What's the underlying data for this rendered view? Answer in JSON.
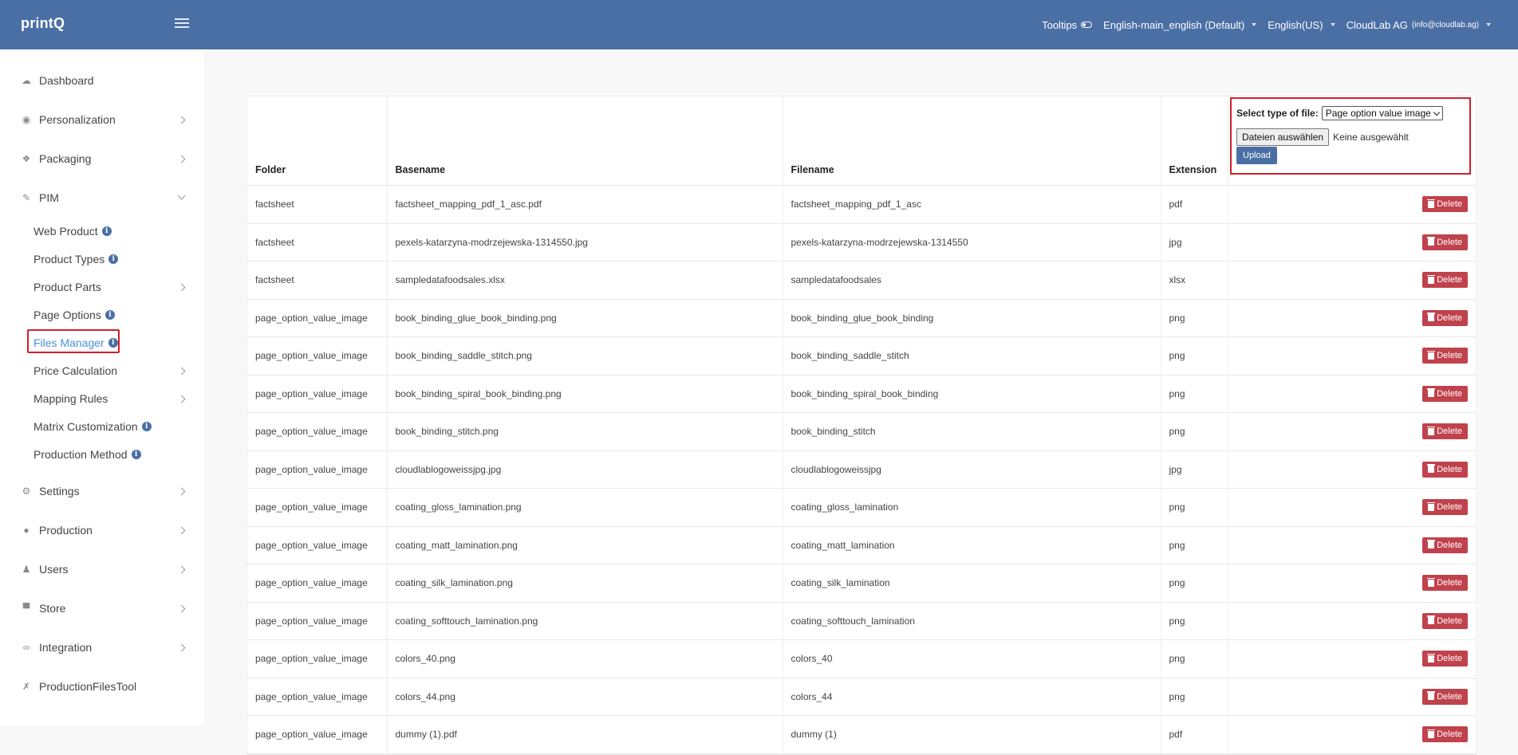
{
  "app": {
    "logo": "printQ"
  },
  "topnav": {
    "tooltips": "Tooltips",
    "language_store": "English-main_english (Default)",
    "locale": "English(US)",
    "account": "CloudLab AG",
    "account_email": "(info@cloudlab.ag)"
  },
  "sidebar": {
    "items": [
      {
        "label": "Dashboard"
      },
      {
        "label": "Personalization"
      },
      {
        "label": "Packaging"
      },
      {
        "label": "PIM"
      },
      {
        "label": "Settings"
      },
      {
        "label": "Production"
      },
      {
        "label": "Users"
      },
      {
        "label": "Store"
      },
      {
        "label": "Integration"
      },
      {
        "label": "ProductionFilesTool"
      }
    ],
    "pim_sub": [
      {
        "label": "Web Product"
      },
      {
        "label": "Product Types"
      },
      {
        "label": "Product Parts"
      },
      {
        "label": "Page Options"
      },
      {
        "label": "Files Manager"
      },
      {
        "label": "Price Calculation"
      },
      {
        "label": "Mapping Rules"
      },
      {
        "label": "Matrix Customization"
      },
      {
        "label": "Production Method"
      }
    ]
  },
  "upload": {
    "select_label": "Select type of file:",
    "selected_type": "Page option value image",
    "choose_files": "Dateien auswählen",
    "no_file": "Keine ausgewählt",
    "upload_button": "Upload"
  },
  "table": {
    "headers": [
      "Folder",
      "Basename",
      "Filename",
      "Extension",
      ""
    ],
    "delete_label": "Delete",
    "rows": [
      [
        "factsheet",
        "factsheet_mapping_pdf_1_asc.pdf",
        "factsheet_mapping_pdf_1_asc",
        "pdf"
      ],
      [
        "factsheet",
        "pexels-katarzyna-modrzejewska-1314550.jpg",
        "pexels-katarzyna-modrzejewska-1314550",
        "jpg"
      ],
      [
        "factsheet",
        "sampledatafoodsales.xlsx",
        "sampledatafoodsales",
        "xlsx"
      ],
      [
        "page_option_value_image",
        "book_binding_glue_book_binding.png",
        "book_binding_glue_book_binding",
        "png"
      ],
      [
        "page_option_value_image",
        "book_binding_saddle_stitch.png",
        "book_binding_saddle_stitch",
        "png"
      ],
      [
        "page_option_value_image",
        "book_binding_spiral_book_binding.png",
        "book_binding_spiral_book_binding",
        "png"
      ],
      [
        "page_option_value_image",
        "book_binding_stitch.png",
        "book_binding_stitch",
        "png"
      ],
      [
        "page_option_value_image",
        "cloudlablogoweissjpg.jpg",
        "cloudlablogoweissjpg",
        "jpg"
      ],
      [
        "page_option_value_image",
        "coating_gloss_lamination.png",
        "coating_gloss_lamination",
        "png"
      ],
      [
        "page_option_value_image",
        "coating_matt_lamination.png",
        "coating_matt_lamination",
        "png"
      ],
      [
        "page_option_value_image",
        "coating_silk_lamination.png",
        "coating_silk_lamination",
        "png"
      ],
      [
        "page_option_value_image",
        "coating_softtouch_lamination.png",
        "coating_softtouch_lamination",
        "png"
      ],
      [
        "page_option_value_image",
        "colors_40.png",
        "colors_40",
        "png"
      ],
      [
        "page_option_value_image",
        "colors_44.png",
        "colors_44",
        "png"
      ],
      [
        "page_option_value_image",
        "dummy (1).pdf",
        "dummy (1)",
        "pdf"
      ]
    ]
  }
}
